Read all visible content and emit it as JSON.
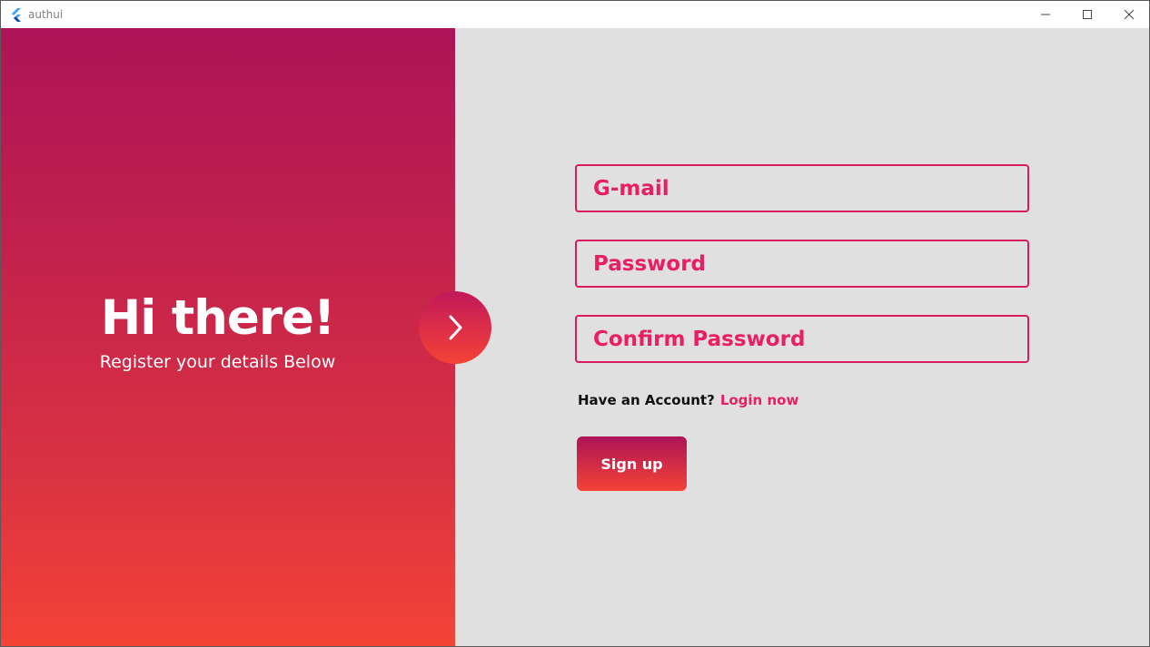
{
  "window": {
    "title": "authui",
    "icon": "flutter-logo-icon",
    "controls": [
      "minimize-icon",
      "maximize-icon",
      "close-icon"
    ]
  },
  "hero": {
    "title": "Hi there!",
    "subtitle": "Register your details Below",
    "next_icon": "chevron-right-icon"
  },
  "form": {
    "email_placeholder": "G-mail",
    "password_placeholder": "Password",
    "confirm_placeholder": "Confirm Password",
    "account_question": "Have an Account?",
    "login_link": "Login now",
    "signup_label": "Sign up"
  },
  "colors": {
    "accent": "#e91e63",
    "gradient_top": "#ad1457",
    "gradient_bottom": "#f44336",
    "panel_bg": "#e0e0e0"
  }
}
